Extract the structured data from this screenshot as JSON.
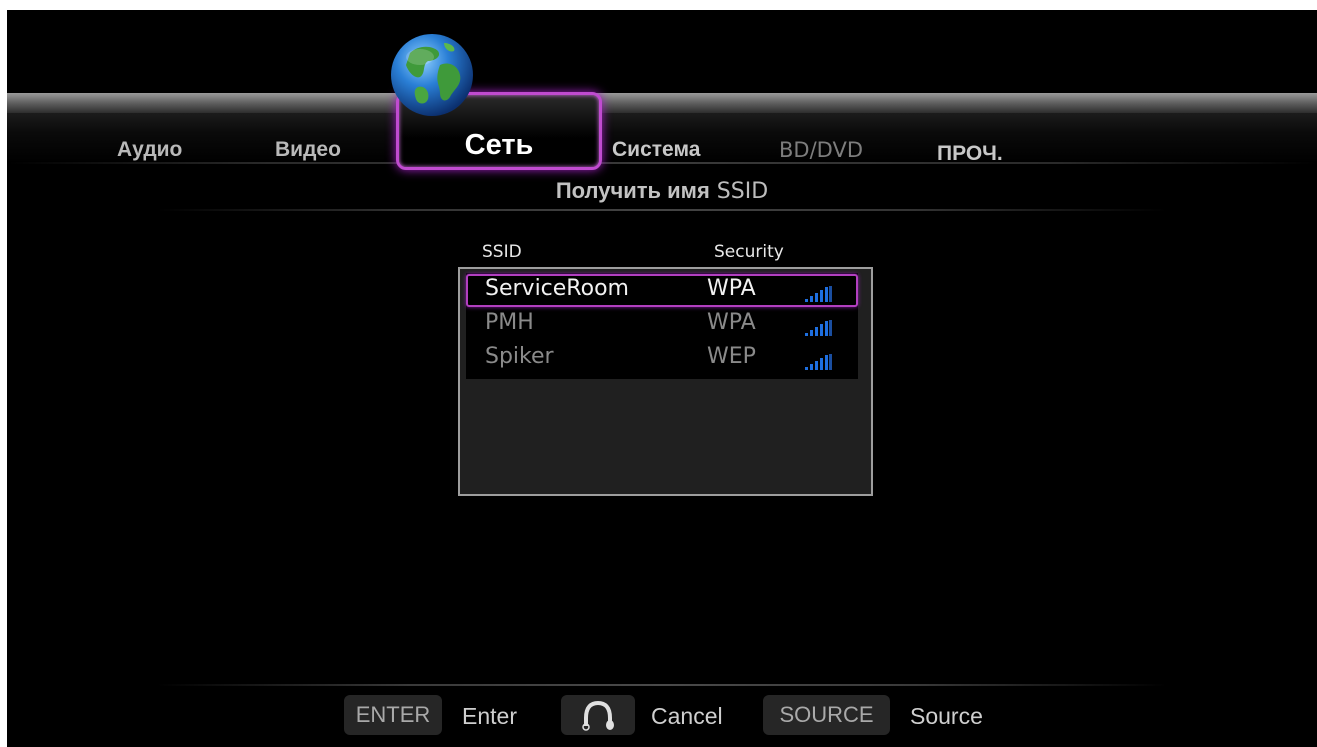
{
  "tabs": [
    {
      "label": "Аудио"
    },
    {
      "label": "Видео"
    },
    {
      "label": "Сеть"
    },
    {
      "label": "Система"
    },
    {
      "label": "BD/DVD"
    },
    {
      "label": "ПРОЧ."
    }
  ],
  "page": {
    "title_bold": "Получить имя",
    "title_plain": "SSID"
  },
  "list": {
    "col_ssid": "SSID",
    "col_security": "Security",
    "rows": [
      {
        "ssid": "ServiceRoom",
        "security": "WPA",
        "selected": true
      },
      {
        "ssid": "PMH",
        "security": "WPA",
        "selected": false
      },
      {
        "ssid": "Spiker",
        "security": "WEP",
        "selected": false
      }
    ]
  },
  "footer": {
    "enter_key": "ENTER",
    "enter_label": "Enter",
    "cancel_icon": "return-icon",
    "cancel_label": "Cancel",
    "source_key": "SOURCE",
    "source_label": "Source"
  },
  "colors": {
    "accent": "#c04bd0",
    "signal": "#1e6fe0"
  }
}
